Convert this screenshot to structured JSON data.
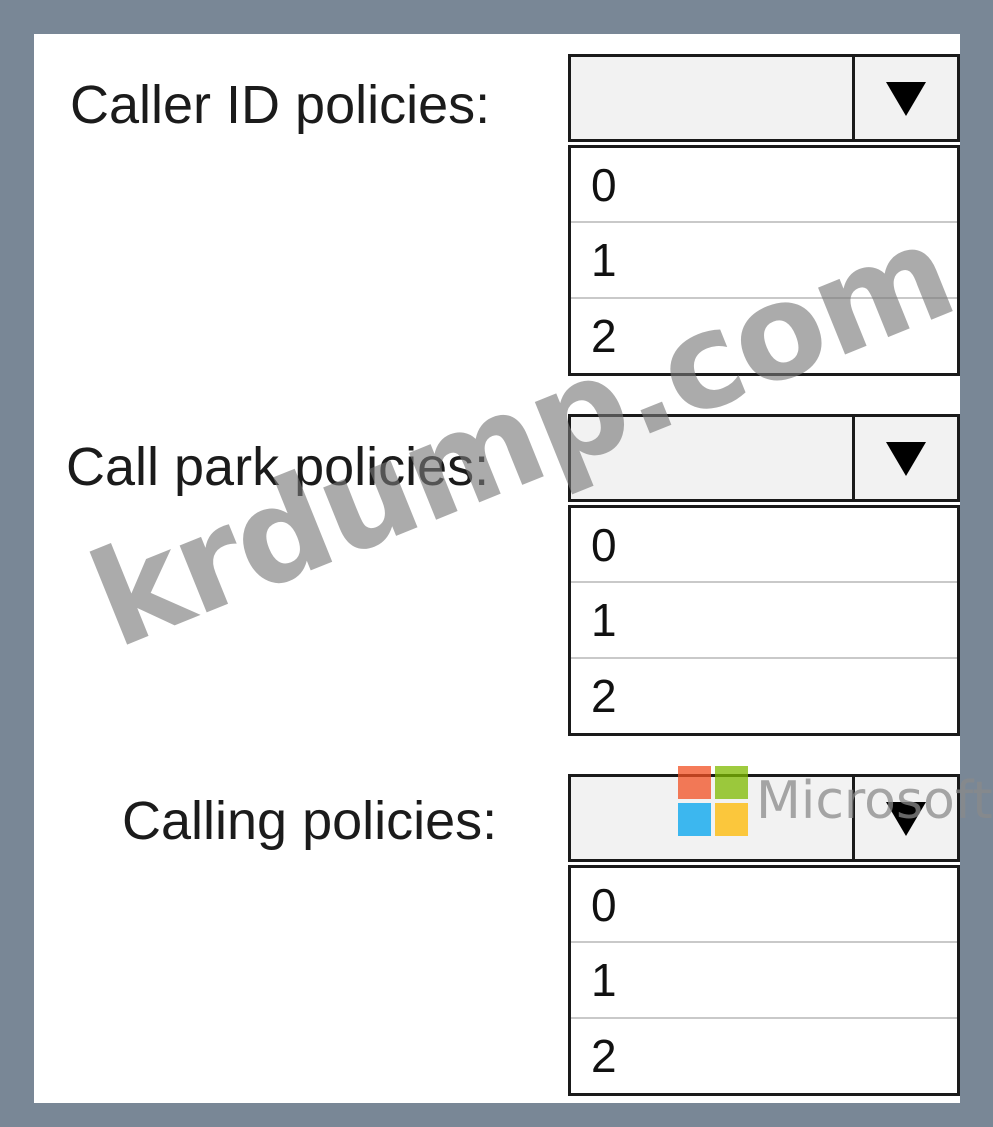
{
  "fields": [
    {
      "label": "Caller ID policies:",
      "selected": "",
      "options": [
        "0",
        "1",
        "2"
      ]
    },
    {
      "label": "Call park policies:",
      "selected": "",
      "options": [
        "0",
        "1",
        "2"
      ]
    },
    {
      "label": "Calling policies:",
      "selected": "",
      "options": [
        "0",
        "1",
        "2"
      ]
    }
  ],
  "icons": {
    "dropdown_arrow": "triangle-down-icon"
  },
  "watermarks": {
    "site": "krdump.com",
    "brand": "Microsoft"
  },
  "colors": {
    "frame": "#798796",
    "panel": "#ffffff",
    "header_bg": "#f2f2f2",
    "border": "#1a1a1a",
    "ms_red": "#f25022",
    "ms_green": "#7fba00",
    "ms_blue": "#00a4ef",
    "ms_yellow": "#ffb900"
  }
}
